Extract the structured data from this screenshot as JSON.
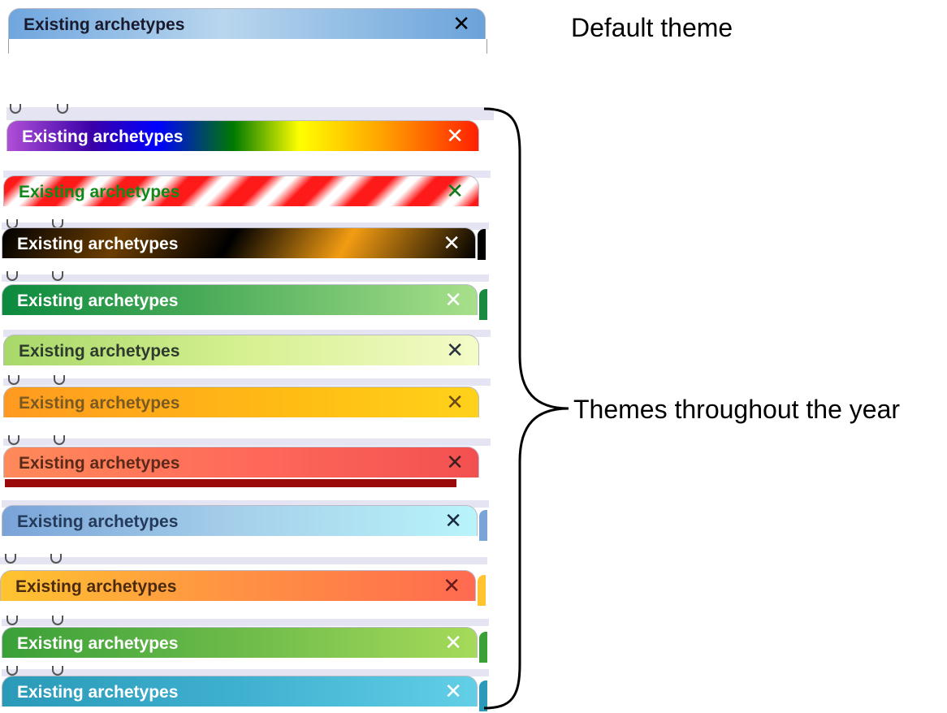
{
  "tab_label": "Existing archetypes",
  "close_glyph": "✕",
  "annotations": {
    "default": "Default theme",
    "seasonal": "Themes throughout the year"
  },
  "themes": [
    {
      "name": "default",
      "text_color": "#1a1a2e",
      "close_color": "#000000",
      "background": "linear-gradient(90deg,#6fa6de 0%,#b9d6ee 45%,#6aa3da 100%)"
    },
    {
      "name": "rainbow",
      "text_color": "#ffffff",
      "close_color": "#ffffff",
      "background": "linear-gradient(90deg,#b04fd6 0%,#3a00a8 18%,#0000ff 32%,#007a00 48%,#ffff00 62%,#ffa000 80%,#ff2000 100%)"
    },
    {
      "name": "candy-stripe",
      "text_color": "#0d8a1a",
      "close_color": "#0d7a18",
      "background": "repeating-linear-gradient(135deg,#ff1a1a 0px,#ff1a1a 16px,#ffffff 30px,#ffffff 38px,#ff1a1a 54px)"
    },
    {
      "name": "black-orange",
      "text_color": "#ffffff",
      "close_color": "#ffffff",
      "background": "linear-gradient(120deg,#000000 0%,#6b3d00 25%,#000000 48%,#f39c12 72%,#000000 100%)"
    },
    {
      "name": "green",
      "text_color": "#ffffff",
      "close_color": "#ffffff",
      "background": "linear-gradient(90deg,#0c8a3e 0%,#46a957 40%,#a8e08a 100%)"
    },
    {
      "name": "lime",
      "text_color": "#2f3a2f",
      "close_color": "#2a3340",
      "background": "linear-gradient(90deg,#a8d86a 0%,#d5f090 50%,#f4fbc8 100%)"
    },
    {
      "name": "amber",
      "text_color": "#7a5a22",
      "close_color": "#6b4a1a",
      "background": "linear-gradient(90deg,#ff9a20 0%,#ffbc14 60%,#ffd21a 100%)"
    },
    {
      "name": "coral",
      "text_color": "#5a2a1a",
      "close_color": "#3a2020",
      "background": "linear-gradient(90deg,#ff8a5a 0%,#ff6a5a 50%,#f25050 100%)"
    },
    {
      "name": "sky",
      "text_color": "#243a5a",
      "close_color": "#1a2840",
      "background": "linear-gradient(90deg,#7aa4d8 0%,#a6d0ea 50%,#b8f4fa 100%)"
    },
    {
      "name": "sunset",
      "text_color": "#4a2a10",
      "close_color": "#6a1a1a",
      "background": "linear-gradient(90deg,#ffc430 0%,#ff9a40 40%,#ff6a50 100%)"
    },
    {
      "name": "leaf",
      "text_color": "#ffffff",
      "close_color": "#ffffff",
      "background": "linear-gradient(90deg,#3aa038 0%,#6dbb4a 50%,#a6da5a 100%)"
    },
    {
      "name": "teal",
      "text_color": "#ffffff",
      "close_color": "#ffffff",
      "background": "linear-gradient(90deg,#2a9ab8 0%,#3fb0d0 50%,#62cfe6 100%)"
    }
  ]
}
